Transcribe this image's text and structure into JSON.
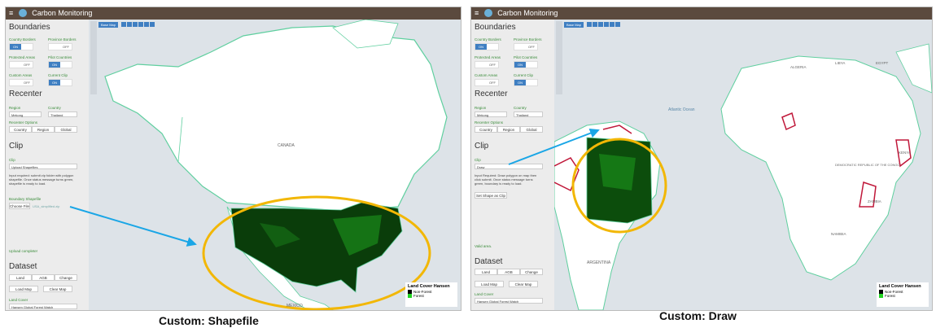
{
  "app_title": "Carbon Monitoring",
  "sections": {
    "boundaries": "Boundaries",
    "recenter": "Recenter",
    "clip": "Clip",
    "dataset": "Dataset"
  },
  "toggles": {
    "country_borders": "Country Borders",
    "province_borders": "Province Borders",
    "protected_areas": "Protected Areas",
    "pilot_countries": "Pilot Countries",
    "custom_areas": "Custom Areas",
    "current_clip": "Current Clip",
    "on": "ON",
    "off": "OFF"
  },
  "recenter": {
    "region_label": "Region",
    "region_value": "Mekong",
    "country_label": "Country",
    "country_value": "Thailand",
    "options_label": "Recenter Options",
    "country_btn": "Country",
    "region_btn": "Region",
    "global_btn": "Global"
  },
  "clip_left": {
    "label": "Clip",
    "value": "Upload Shapefiles",
    "help": "Input required: submit zip folder with polygon shapefile. Once status message turns green, shapefile is ready to load.",
    "boundary_label": "Boundary Shapefile",
    "choose_file": "Choose File",
    "file_name": "USA_simplified.zip",
    "status": "Upload complete!"
  },
  "clip_right": {
    "label": "Clip",
    "value": "Draw",
    "help": "Input Required: Draw polygon on map then click submit. Once status message turns green, boundary is ready to load.",
    "set_shape": "Set Shape as Clip",
    "status": "Valid area."
  },
  "dataset": {
    "land": "Land",
    "agb": "AGB",
    "change": "Change",
    "load_map": "Load Map",
    "clear_map": "Clear Map",
    "land_cover_label": "Land Cover",
    "land_cover_value": "Hansen Global Forest Watch"
  },
  "map": {
    "base_map": "Base Map",
    "canada": "CANADA",
    "mexico": "MEXICO",
    "atlantic": "Atlantic Ocean",
    "argentina": "ARGENTINA",
    "brazil": "BRAZIL",
    "algeria": "ALGERIA",
    "libya": "LIBYA",
    "egypt": "EGYPT",
    "drc": "DEMOCRATIC REPUBLIC OF THE CONGO",
    "zambia": "ZAMBIA",
    "kenya": "KENYA",
    "namibia": "NAMIBIA"
  },
  "legend": {
    "title": "Land Cover Hansen",
    "non_forest": "Non-Forest",
    "forest": "Forest",
    "non_forest_color": "#000000",
    "forest_color": "#22d322"
  },
  "captions": {
    "left": "Custom: Shapefile",
    "right": "Custom: Draw"
  },
  "colors": {
    "title_bar": "#5b4a3e",
    "accent": "#3f7fc2",
    "highlight_ring": "#f2b705",
    "arrow": "#1aa6e6",
    "border": "#5fcf9f"
  }
}
